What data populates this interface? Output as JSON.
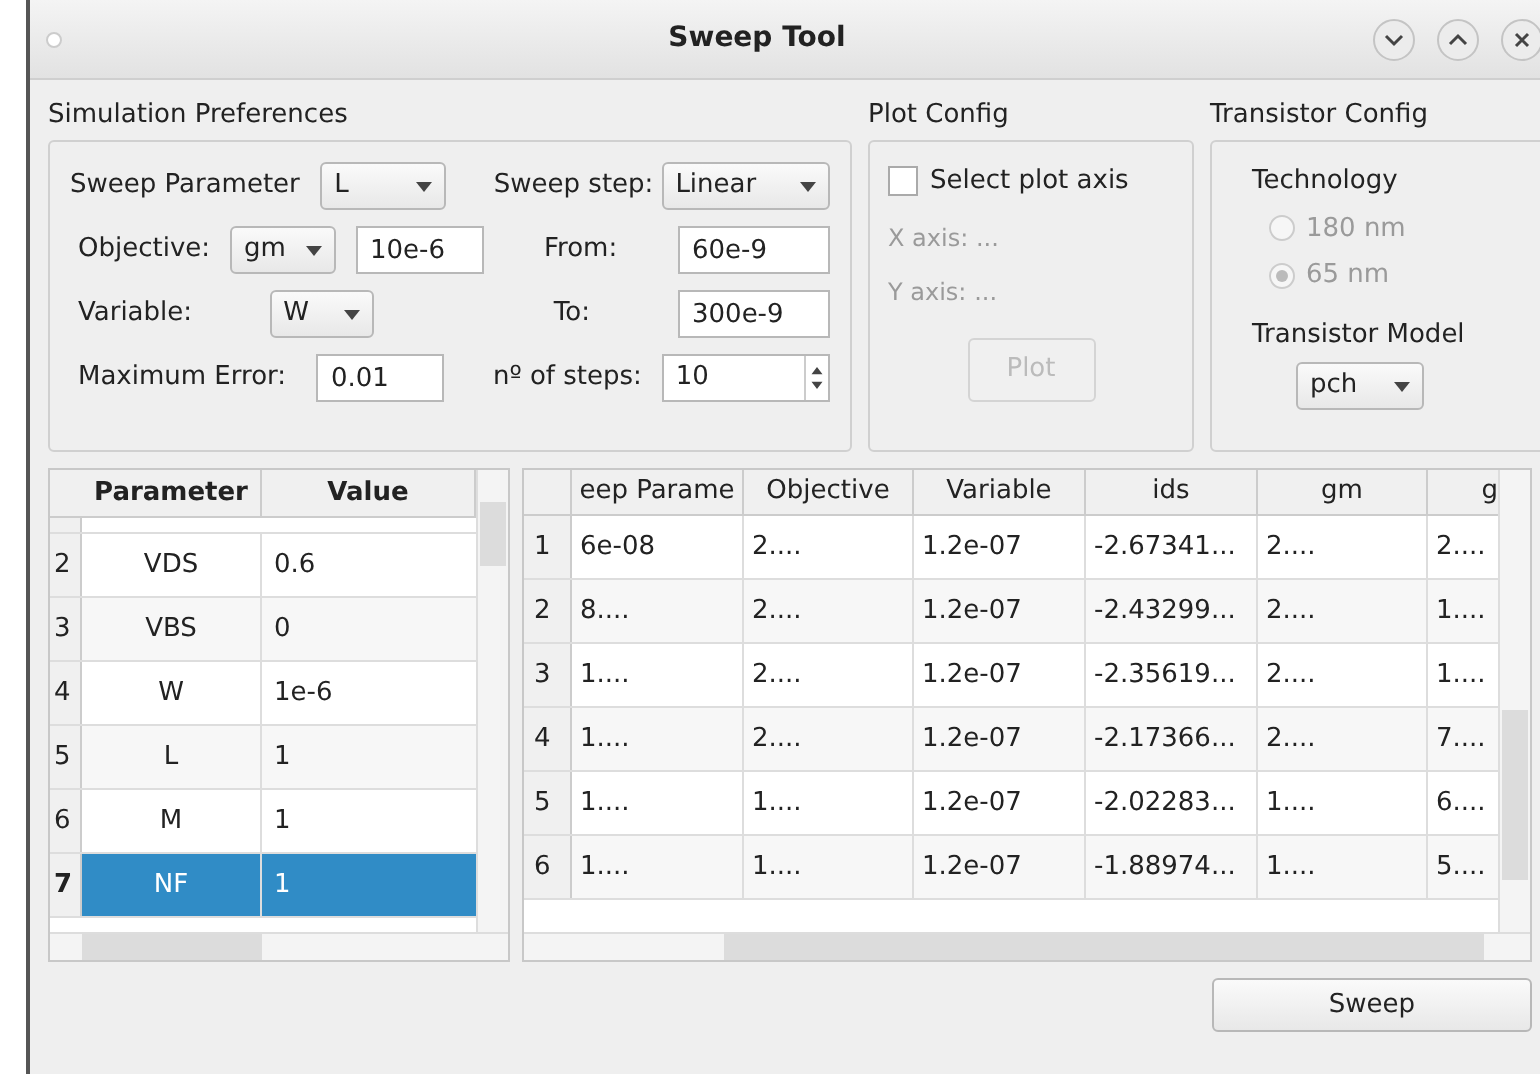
{
  "window": {
    "title": "Sweep Tool"
  },
  "simulation_preferences": {
    "title": "Simulation Preferences",
    "sweep_parameter": {
      "label": "Sweep Parameter",
      "value": "L"
    },
    "sweep_step": {
      "label": "Sweep step:",
      "value": "Linear"
    },
    "objective": {
      "label": "Objective:",
      "value": "gm",
      "target": "10e-6"
    },
    "from": {
      "label": "From:",
      "value": "60e-9"
    },
    "variable": {
      "label": "Variable:",
      "value": "W"
    },
    "to": {
      "label": "To:",
      "value": "300e-9"
    },
    "max_error": {
      "label": "Maximum Error:",
      "value": "0.01"
    },
    "steps": {
      "label": "nº of steps:",
      "value": "10"
    }
  },
  "plot_config": {
    "title": "Plot Config",
    "select_axis": {
      "label": "Select plot axis",
      "checked": false
    },
    "axes": [
      {
        "label": "X axis:",
        "value": "...",
        "disabled": true
      },
      {
        "label": "Y axis:",
        "value": "...",
        "disabled": true
      }
    ],
    "plot_button": {
      "label": "Plot",
      "disabled": true
    }
  },
  "transistor_config": {
    "title": "Transistor Config",
    "technology_label": "Technology",
    "technologies": [
      {
        "label": "180 nm",
        "selected": false,
        "disabled": true
      },
      {
        "label": "65 nm",
        "selected": true,
        "disabled": true
      }
    ],
    "model_label": "Transistor Model",
    "model_value": "pch"
  },
  "parameter_table": {
    "columns": [
      "Parameter",
      "Value"
    ],
    "rows": [
      {
        "index": "2",
        "parameter": "VDS",
        "value": "0.6",
        "selected": false
      },
      {
        "index": "3",
        "parameter": "VBS",
        "value": "0",
        "selected": false
      },
      {
        "index": "4",
        "parameter": "W",
        "value": "1e-6",
        "selected": false
      },
      {
        "index": "5",
        "parameter": "L",
        "value": "1",
        "selected": false
      },
      {
        "index": "6",
        "parameter": "M",
        "value": "1",
        "selected": false
      },
      {
        "index": "7",
        "parameter": "NF",
        "value": "1",
        "selected": true
      }
    ]
  },
  "results_table": {
    "columns": [
      "eep Parame",
      "Objective",
      "Variable",
      "ids",
      "gm",
      "g"
    ],
    "rows": [
      {
        "index": "1",
        "cells": [
          "6e-08",
          "2....",
          "1.2e-07",
          "-2.67341...",
          "2....",
          "2...."
        ]
      },
      {
        "index": "2",
        "cells": [
          "8....",
          "2....",
          "1.2e-07",
          "-2.43299...",
          "2....",
          "1...."
        ]
      },
      {
        "index": "3",
        "cells": [
          "1....",
          "2....",
          "1.2e-07",
          "-2.35619...",
          "2....",
          "1...."
        ]
      },
      {
        "index": "4",
        "cells": [
          "1....",
          "2....",
          "1.2e-07",
          "-2.17366...",
          "2....",
          "7...."
        ]
      },
      {
        "index": "5",
        "cells": [
          "1....",
          "1....",
          "1.2e-07",
          "-2.02283...",
          "1....",
          "6...."
        ]
      },
      {
        "index": "6",
        "cells": [
          "1....",
          "1....",
          "1.2e-07",
          "-1.88974...",
          "1....",
          "5...."
        ]
      }
    ]
  },
  "sweep_button": {
    "label": "Sweep"
  }
}
